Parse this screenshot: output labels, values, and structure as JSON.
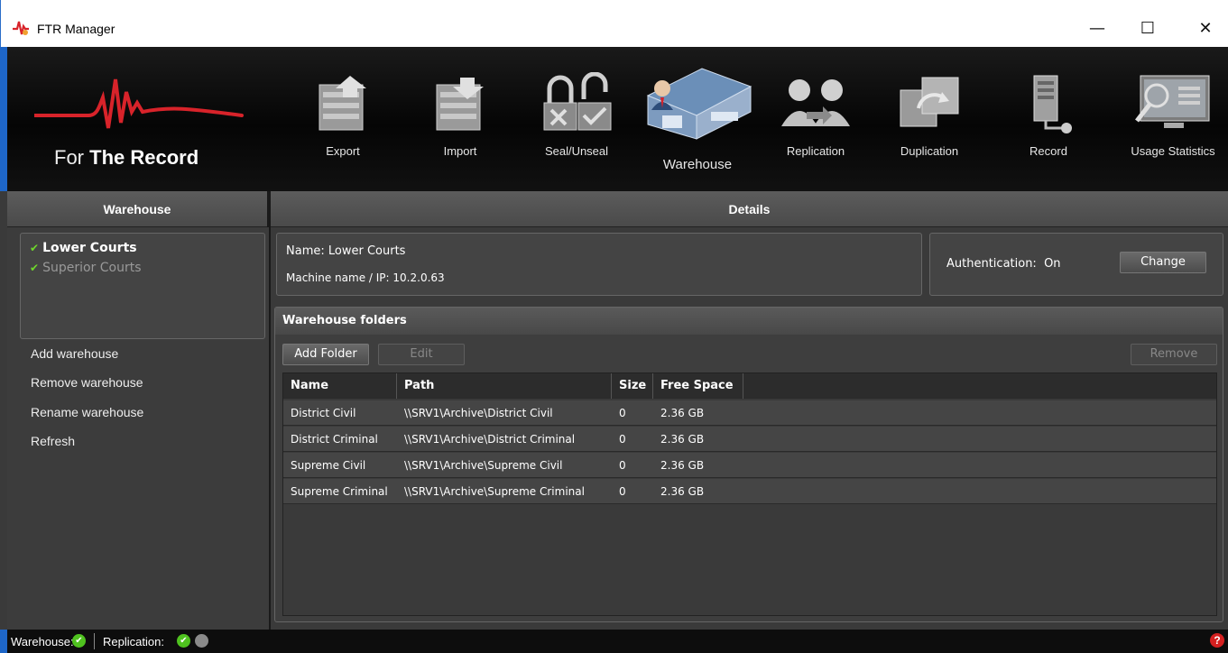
{
  "window": {
    "title": "FTR Manager",
    "minimize": "—",
    "maximize": "☐",
    "close": "✕"
  },
  "brand": {
    "logo_prefix": "For ",
    "logo_bold": "The Record",
    "accent": "#d8232a"
  },
  "toolbar": {
    "items": [
      {
        "label": "Export",
        "icon": "export-icon"
      },
      {
        "label": "Import",
        "icon": "import-icon"
      },
      {
        "label": "Seal/Unseal",
        "icon": "lock-icon"
      },
      {
        "label": "Warehouse",
        "icon": "warehouse-icon",
        "active": true
      },
      {
        "label": "Replication",
        "icon": "replication-icon"
      },
      {
        "label": "Duplication",
        "icon": "duplication-icon"
      },
      {
        "label": "Record",
        "icon": "record-icon"
      },
      {
        "label": "Usage Statistics",
        "icon": "usage-statistics-icon"
      }
    ]
  },
  "left": {
    "header": "Warehouse",
    "warehouses": [
      {
        "name": "Lower Courts",
        "selected": true,
        "status": "ok"
      },
      {
        "name": "Superior Courts",
        "selected": false,
        "status": "ok"
      }
    ],
    "actions": [
      "Add warehouse",
      "Remove warehouse",
      "Rename warehouse",
      "Refresh"
    ]
  },
  "details": {
    "header": "Details",
    "name_label": "Name:",
    "name_value": "Lower Courts",
    "machine_label": "Machine name / IP:",
    "machine_value": "10.2.0.63",
    "auth_label": "Authentication:",
    "auth_value": "On",
    "change_label": "Change"
  },
  "folders": {
    "title": "Warehouse folders",
    "add_label": "Add Folder",
    "edit_label": "Edit",
    "remove_label": "Remove",
    "columns": [
      "Name",
      "Path",
      "Size",
      "Free Space"
    ],
    "rows": [
      [
        "District Civil",
        "\\\\SRV1\\Archive\\District Civil",
        "0",
        "2.36 GB"
      ],
      [
        "District Criminal",
        "\\\\SRV1\\Archive\\District Criminal",
        "0",
        "2.36 GB"
      ],
      [
        "Supreme Civil",
        "\\\\SRV1\\Archive\\Supreme Civil",
        "0",
        "2.36 GB"
      ],
      [
        "Supreme Criminal",
        "\\\\SRV1\\Archive\\Supreme Criminal",
        "0",
        "2.36 GB"
      ]
    ]
  },
  "status": {
    "warehouse_label": "Warehouse:",
    "replication_label": "Replication:",
    "help": "?",
    "ok_color": "#4fc21f"
  }
}
